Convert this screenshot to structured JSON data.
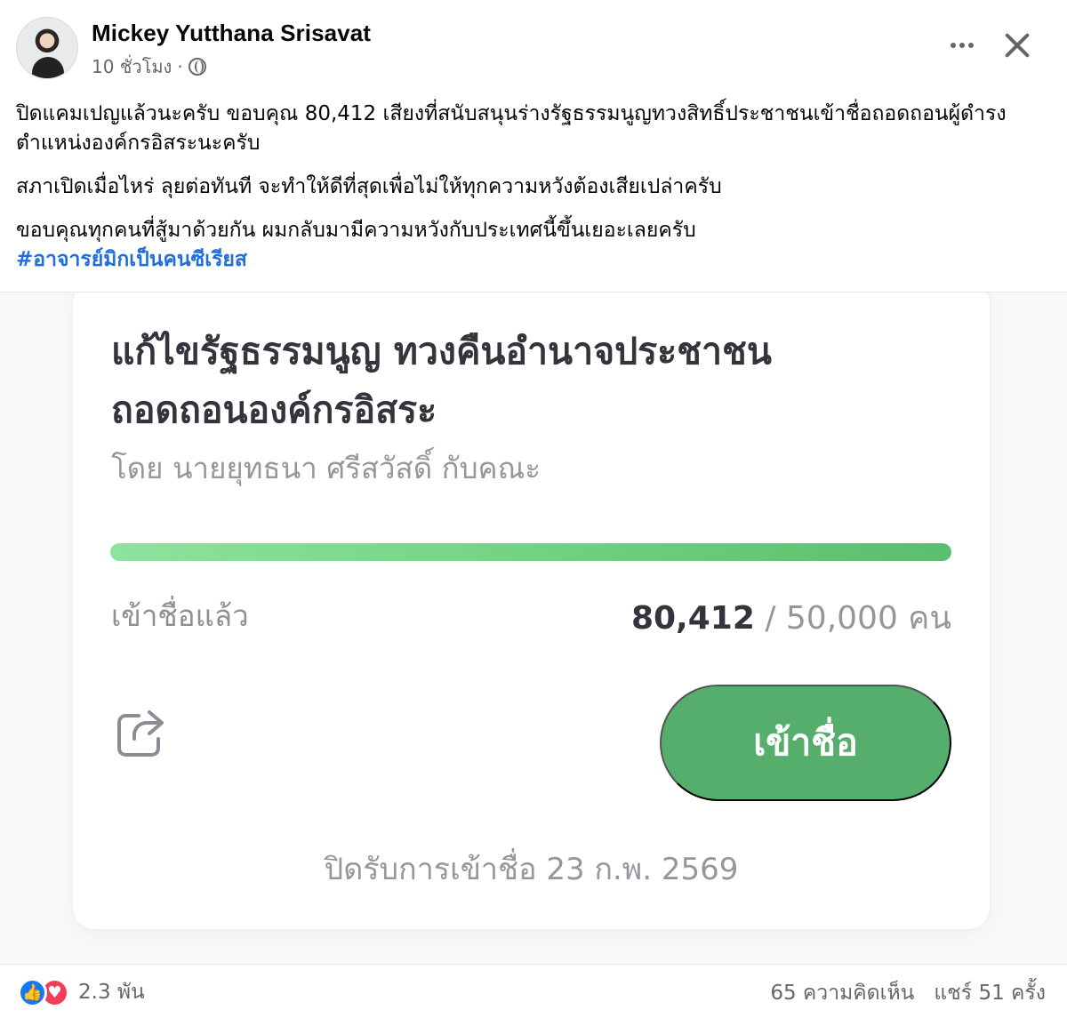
{
  "post": {
    "author": "Mickey Yutthana Srisavat",
    "time": "10 ชั่วโมง",
    "separator": "·",
    "paragraphs": [
      "ปิดแคมเปญแล้วนะครับ ขอบคุณ 80,412 เสียงที่สนับสนุนร่างรัฐธรรมนูญทวงสิทธิ์ประชาชนเข้าชื่อถอดถอนผู้ดำรงตำแหน่งองค์กรอิสระนะครับ",
      "สภาเปิดเมื่อไหร่ ลุยต่อทันที จะทำให้ดีที่สุดเพื่อไม่ให้ทุกความหวังต้องเสียเปล่าครับ",
      "ขอบคุณทุกคนที่สู้มาด้วยกัน ผมกลับมามีความหวังกับประเทศนี้ขึ้นเยอะเลยครับ"
    ],
    "hashtag": "#อาจารย์มิกเป็นคนซีเรียส"
  },
  "card": {
    "title_line1": "แก้ไขรัฐธรรมนูญ ทวงคืนอำนาจประชาชน",
    "title_line2": "ถอดถอนองค์กรอิสระ",
    "subtitle": "โดย นายยุทธนา ศรีสวัสดิ์ กับคณะ",
    "progress_fraction": 1.0,
    "progress_label": "เข้าชื่อแล้ว",
    "signed_count": "80,412",
    "target_text": "/ 50,000 คน",
    "signup_button": "เข้าชื่อ",
    "closing_date": "ปิดรับการเข้าชื่อ 23 ก.พ. 2569",
    "accent_color": "#56ae6d",
    "progress_colors": [
      "#8ee39e",
      "#59be6e"
    ]
  },
  "footer": {
    "reaction_count": "2.3 พัน",
    "comments": "65 ความคิดเห็น",
    "shares": "แชร์ 51 ครั้ง"
  },
  "icons": {
    "more": "more-options-icon",
    "close": "close-icon",
    "privacy": "public-globe-icon",
    "share": "share-icon",
    "like": "like-icon",
    "love": "love-icon"
  }
}
